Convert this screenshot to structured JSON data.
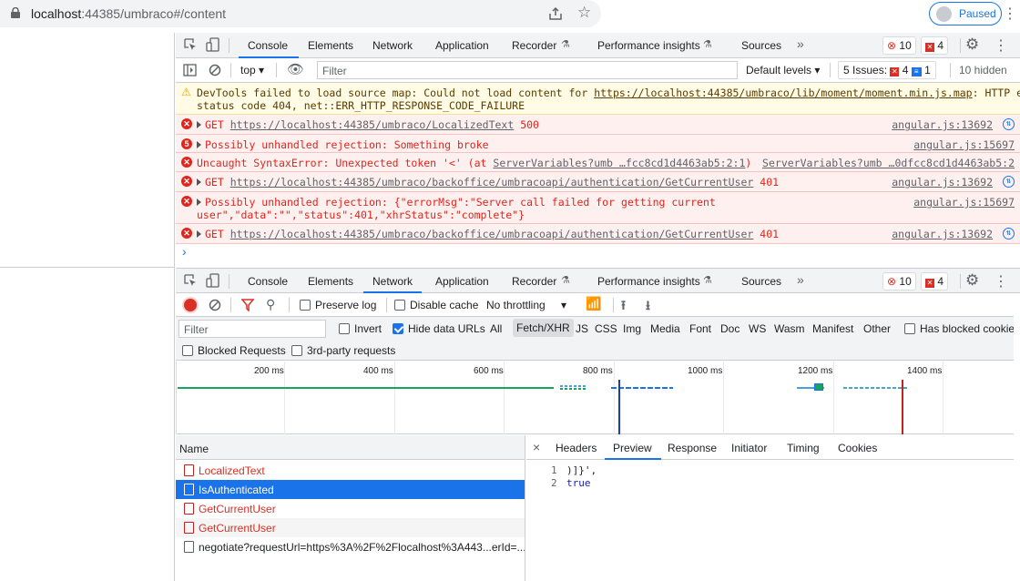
{
  "browser": {
    "url_host": "localhost",
    "url_rest": ":44385/umbraco#/content",
    "profile_label": "Paused"
  },
  "top_devtools": {
    "tabs": [
      "Console",
      "Elements",
      "Network",
      "Application",
      "Recorder",
      "Performance insights",
      "Sources"
    ],
    "selected_tab": "Console",
    "error_count": "10",
    "issue_count": "4",
    "context": "top",
    "filter_placeholder": "Filter",
    "levels": "Default levels",
    "issues_label": "5 Issues:",
    "issues_err": "4",
    "issues_info": "1",
    "hidden_label": "10 hidden"
  },
  "console": {
    "messages": [
      {
        "type": "warn",
        "text": "DevTools failed to load source map: Could not load content for ",
        "link": "https://localhost:44385/umbraco/lib/moment/moment.min.js.map",
        "text2": ": HTTP error:",
        "line2": "status code 404, net::ERR_HTTP_RESPONSE_CODE_FAILURE"
      },
      {
        "type": "err",
        "prefix": "GET ",
        "link": "https://localhost:44385/umbraco/LocalizedText",
        "suffix": " 500",
        "source": "angular.js:13692"
      },
      {
        "type": "err",
        "count": "5",
        "text": "Possibly unhandled rejection: Something broke",
        "source": "angular.js:15697"
      },
      {
        "type": "err",
        "text": "Uncaught SyntaxError: Unexpected token '<' (at ",
        "link": "ServerVariables?umb …fcc8cd1d4463ab5:2:1",
        "suffix": ")",
        "source": "ServerVariables?umb …0dfcc8cd1d4463ab5:2"
      },
      {
        "type": "err",
        "prefix": "GET ",
        "link": "https://localhost:44385/umbraco/backoffice/umbracoapi/authentication/GetCurrentUser",
        "suffix": " 401",
        "source": "angular.js:13692"
      },
      {
        "type": "err",
        "text": "Possibly unhandled rejection: {\"errorMsg\":\"Server call failed for getting current",
        "line2": "user\",\"data\":\"\",\"status\":401,\"xhrStatus\":\"complete\"}",
        "source": "angular.js:15697"
      },
      {
        "type": "err",
        "prefix": "GET ",
        "link": "https://localhost:44385/umbraco/backoffice/umbracoapi/authentication/GetCurrentUser",
        "suffix": " 401",
        "source": "angular.js:13692"
      }
    ],
    "prompt": "›"
  },
  "bottom_devtools": {
    "tabs": [
      "Console",
      "Elements",
      "Network",
      "Application",
      "Recorder",
      "Performance insights",
      "Sources"
    ],
    "selected_tab": "Network",
    "error_count": "10",
    "issue_count": "4"
  },
  "network": {
    "preserve_log": "Preserve log",
    "disable_cache": "Disable cache",
    "throttling": "No throttling",
    "filter_placeholder": "Filter",
    "invert": "Invert",
    "hide_data_urls": "Hide data URLs",
    "types": [
      "All",
      "Fetch/XHR",
      "JS",
      "CSS",
      "Img",
      "Media",
      "Font",
      "Doc",
      "WS",
      "Wasm",
      "Manifest",
      "Other"
    ],
    "selected_type": "Fetch/XHR",
    "has_blocked_cookies": "Has blocked cookie",
    "blocked_requests": "Blocked Requests",
    "third_party": "3rd-party requests",
    "timeline_ticks": [
      "200 ms",
      "400 ms",
      "600 ms",
      "800 ms",
      "1000 ms",
      "1200 ms",
      "1400 ms"
    ],
    "name_header": "Name",
    "requests": [
      {
        "name": "LocalizedText",
        "status": "error"
      },
      {
        "name": "IsAuthenticated",
        "status": "selected"
      },
      {
        "name": "GetCurrentUser",
        "status": "error"
      },
      {
        "name": "GetCurrentUser",
        "status": "error"
      },
      {
        "name": "negotiate?requestUrl=https%3A%2F%2Flocalhost%3A443...erId=...",
        "status": "ok"
      }
    ],
    "detail_tabs": [
      "Headers",
      "Preview",
      "Response",
      "Initiator",
      "Timing",
      "Cookies"
    ],
    "selected_detail_tab": "Preview",
    "preview_lines": [
      {
        "num": "1",
        "text": ")]}',"
      },
      {
        "num": "2",
        "text": "true"
      }
    ]
  }
}
